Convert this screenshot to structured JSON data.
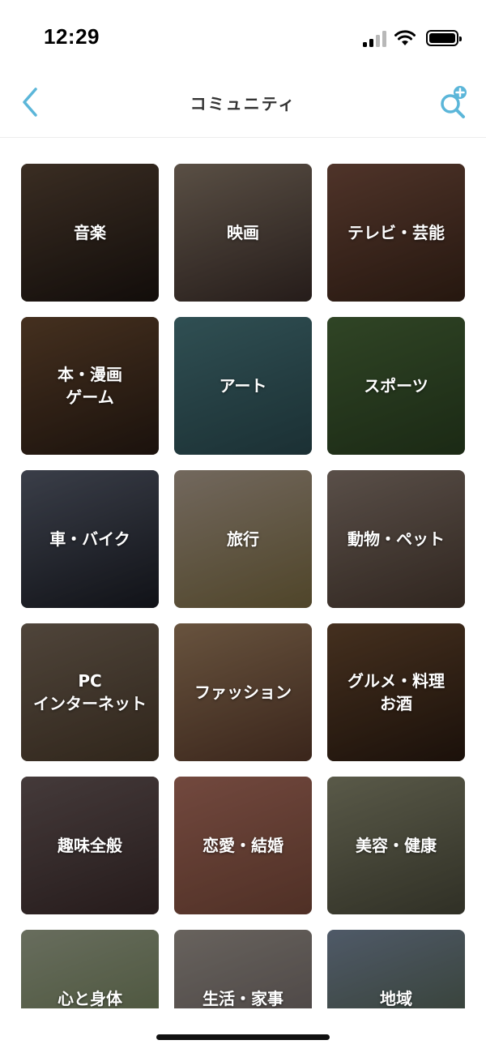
{
  "status_bar": {
    "time": "12:29",
    "icons": [
      "signal-icon",
      "wifi-icon",
      "battery-icon"
    ]
  },
  "nav": {
    "title": "コミュニティ",
    "back_icon": "chevron-left-icon",
    "action_icon": "search-add-icon",
    "accent_color": "#5BB6D9"
  },
  "categories": [
    {
      "id": "music",
      "label": "音楽",
      "colors": [
        "#5a4636",
        "#1c1410"
      ]
    },
    {
      "id": "movie",
      "label": "映画",
      "colors": [
        "#8a7a6a",
        "#3a2c28"
      ]
    },
    {
      "id": "tv",
      "label": "テレビ・芸能",
      "colors": [
        "#7a5040",
        "#3a2418"
      ]
    },
    {
      "id": "books",
      "label": "本・漫画\nゲーム",
      "colors": [
        "#6a4a30",
        "#2a1c14"
      ]
    },
    {
      "id": "art",
      "label": "アート",
      "colors": [
        "#4a7a80",
        "#2a4a50"
      ]
    },
    {
      "id": "sports",
      "label": "スポーツ",
      "colors": [
        "#4a6a3a",
        "#2a4020"
      ]
    },
    {
      "id": "car",
      "label": "車・バイク",
      "colors": [
        "#5a6070",
        "#1a1c24"
      ]
    },
    {
      "id": "travel",
      "label": "旅行",
      "colors": [
        "#b0a090",
        "#7a6a40"
      ]
    },
    {
      "id": "pets",
      "label": "動物・ペット",
      "colors": [
        "#8a7a70",
        "#4a3a30"
      ]
    },
    {
      "id": "pc",
      "label": "PC\nインターネット",
      "colors": [
        "#7a6a5a",
        "#4a3a2a"
      ]
    },
    {
      "id": "fashion",
      "label": "ファッション",
      "colors": [
        "#a08060",
        "#5a3a2a"
      ]
    },
    {
      "id": "gourmet",
      "label": "グルメ・料理\nお酒",
      "colors": [
        "#6a4a30",
        "#2a1a10"
      ]
    },
    {
      "id": "hobby",
      "label": "趣味全般",
      "colors": [
        "#6a5a5a",
        "#3a2a2a"
      ]
    },
    {
      "id": "love",
      "label": "恋愛・結婚",
      "colors": [
        "#b07060",
        "#7a4a3a"
      ]
    },
    {
      "id": "beauty",
      "label": "美容・健康",
      "colors": [
        "#8a8a70",
        "#4a4a3a"
      ]
    },
    {
      "id": "mind",
      "label": "心と身体",
      "colors": [
        "#a0a890",
        "#6a7a50"
      ]
    },
    {
      "id": "life",
      "label": "生活・家事",
      "colors": [
        "#a09890",
        "#6a6060"
      ]
    },
    {
      "id": "region",
      "label": "地域",
      "colors": [
        "#7a8aa0",
        "#4a5a40"
      ]
    }
  ]
}
